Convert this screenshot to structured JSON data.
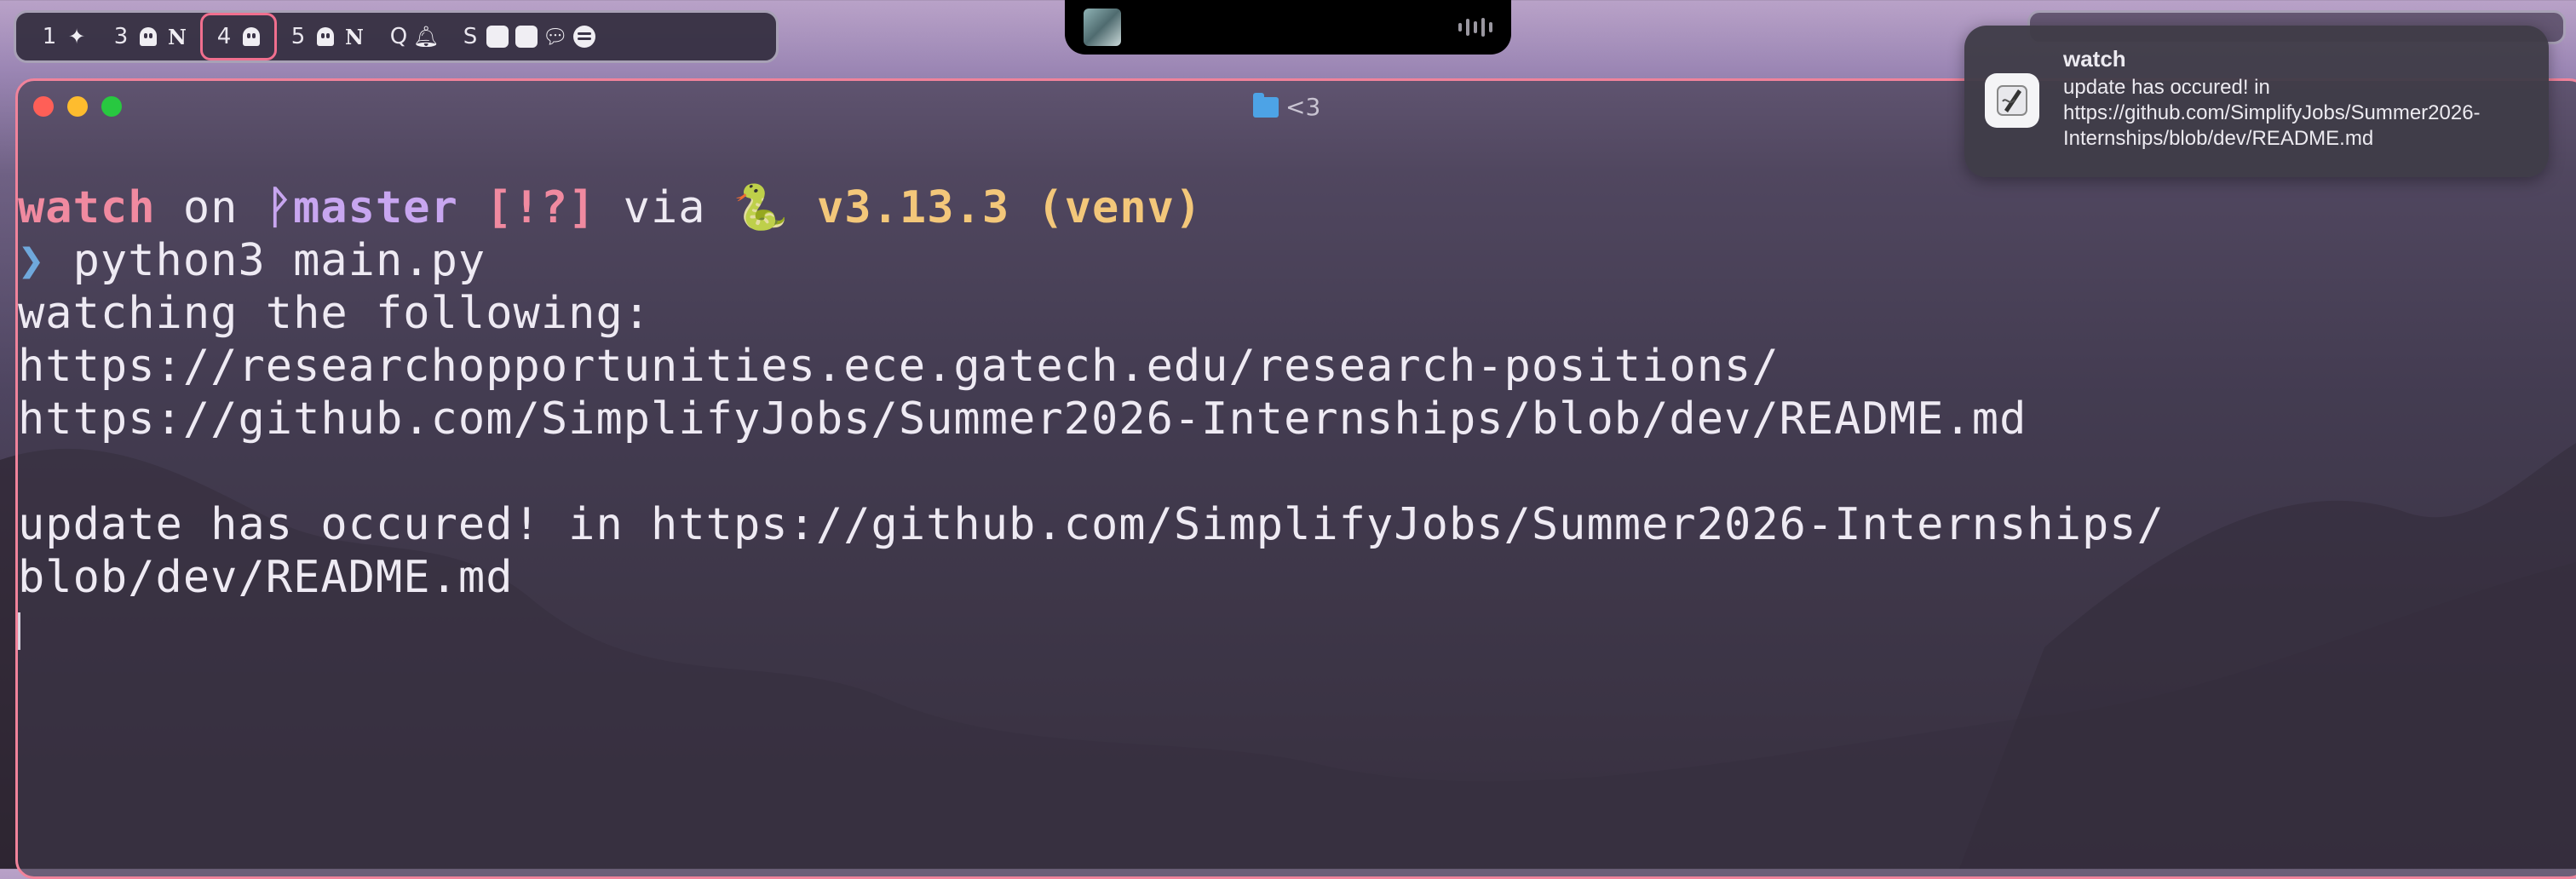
{
  "workspaces": [
    {
      "num": "1",
      "icons": [
        "bird-icon"
      ],
      "active": false
    },
    {
      "num": "3",
      "icons": [
        "ghost-icon",
        "notion-icon"
      ],
      "active": false
    },
    {
      "num": "4",
      "icons": [
        "ghost-icon"
      ],
      "active": true
    },
    {
      "num": "5",
      "icons": [
        "ghost-icon",
        "notion-icon"
      ],
      "active": false
    },
    {
      "num": "Q",
      "icons": [
        "bell-icon"
      ],
      "active": false
    },
    {
      "num": "S",
      "icons": [
        "finder-icon",
        "finder-icon",
        "messages-icon",
        "spotify-icon"
      ],
      "active": false
    }
  ],
  "terminal": {
    "window_title": "<3",
    "prompt": {
      "dir": "watch",
      "on": " on ",
      "branch_symbol": "ᚹ",
      "branch": "master",
      "status": " [!?]",
      "via": " via ",
      "snake": "🐍",
      "version": " v3.13.3 (venv)"
    },
    "command_arrow": "❯",
    "command": " python3 main.py",
    "output": [
      "watching the following:",
      "https://researchopportunities.ece.gatech.edu/research-positions/",
      "https://github.com/SimplifyJobs/Summer2026-Internships/blob/dev/README.md",
      "",
      "update has occured! in https://github.com/SimplifyJobs/Summer2026-Internships/",
      "blob/dev/README.md"
    ]
  },
  "notification": {
    "app": "watch",
    "body": "update has occured! in https://github.com/SimplifyJobs/Summer2026-Internships/blob/dev/README.md"
  },
  "colors": {
    "accent": "#f1839b",
    "prompt_dir": "#f08aa0",
    "prompt_branch": "#c8a6f0",
    "prompt_version": "#f3c77a",
    "prompt_arrow": "#6fa8dc"
  }
}
